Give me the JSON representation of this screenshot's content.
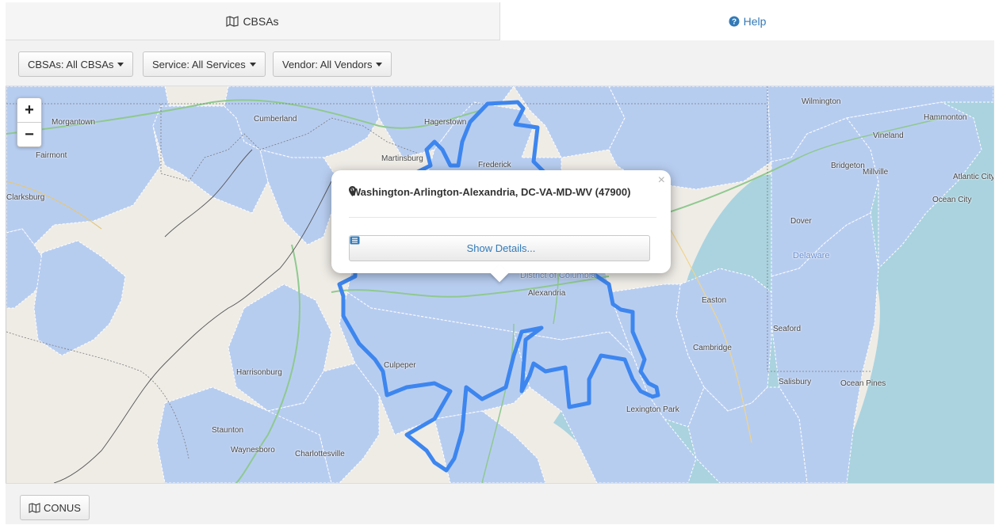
{
  "tabs": {
    "cbsas": {
      "label": "CBSAs",
      "icon": "map-icon"
    },
    "help": {
      "label": "Help",
      "icon": "question-circle-icon"
    }
  },
  "filters": [
    {
      "label": "CBSAs: All CBSAs"
    },
    {
      "label": "Service: All Services"
    },
    {
      "label": "Vendor: All Vendors"
    }
  ],
  "map": {
    "zoom_in": "+",
    "zoom_out": "−",
    "popup": {
      "title": "Washington-Arlington-Alexandria, DC-VA-MD-WV (47900)",
      "button": "Show Details...",
      "close": "×"
    },
    "labels": {
      "morgantown": "Morgantown",
      "fairmont": "Fairmont",
      "clarksburg": "Clarksburg",
      "cumberland": "Cumberland",
      "hagerstown": "Hagerstown",
      "martinsburg": "Martinsburg",
      "frederick": "Frederick",
      "wilmington": "Wilmington",
      "hammonton": "Hammonton",
      "vineland": "Vineland",
      "bridgeton": "Bridgeton",
      "millville": "Millville",
      "atlantic_city": "Atlantic City",
      "ocean_city": "Ocean City",
      "dover": "Dover",
      "delaware": "Delaware",
      "district_of_columbia": "District of Columbia",
      "alexandria": "Alexandria",
      "easton": "Easton",
      "seaford": "Seaford",
      "cambridge": "Cambridge",
      "culpeper": "Culpeper",
      "harrisonburg": "Harrisonburg",
      "salisbury": "Salisbury",
      "ocean_pines": "Ocean Pines",
      "lexington_park": "Lexington Park",
      "staunton": "Staunton",
      "waynesboro": "Waynesboro",
      "charlottesville": "Charlottesville"
    }
  },
  "footer": {
    "conus": "CONUS"
  },
  "colors": {
    "accent": "#337ab7",
    "cbsa_fill": "#b7cdf0",
    "selected_outline": "#3d86ef",
    "map_land": "#efece6",
    "water": "#aad3df"
  }
}
